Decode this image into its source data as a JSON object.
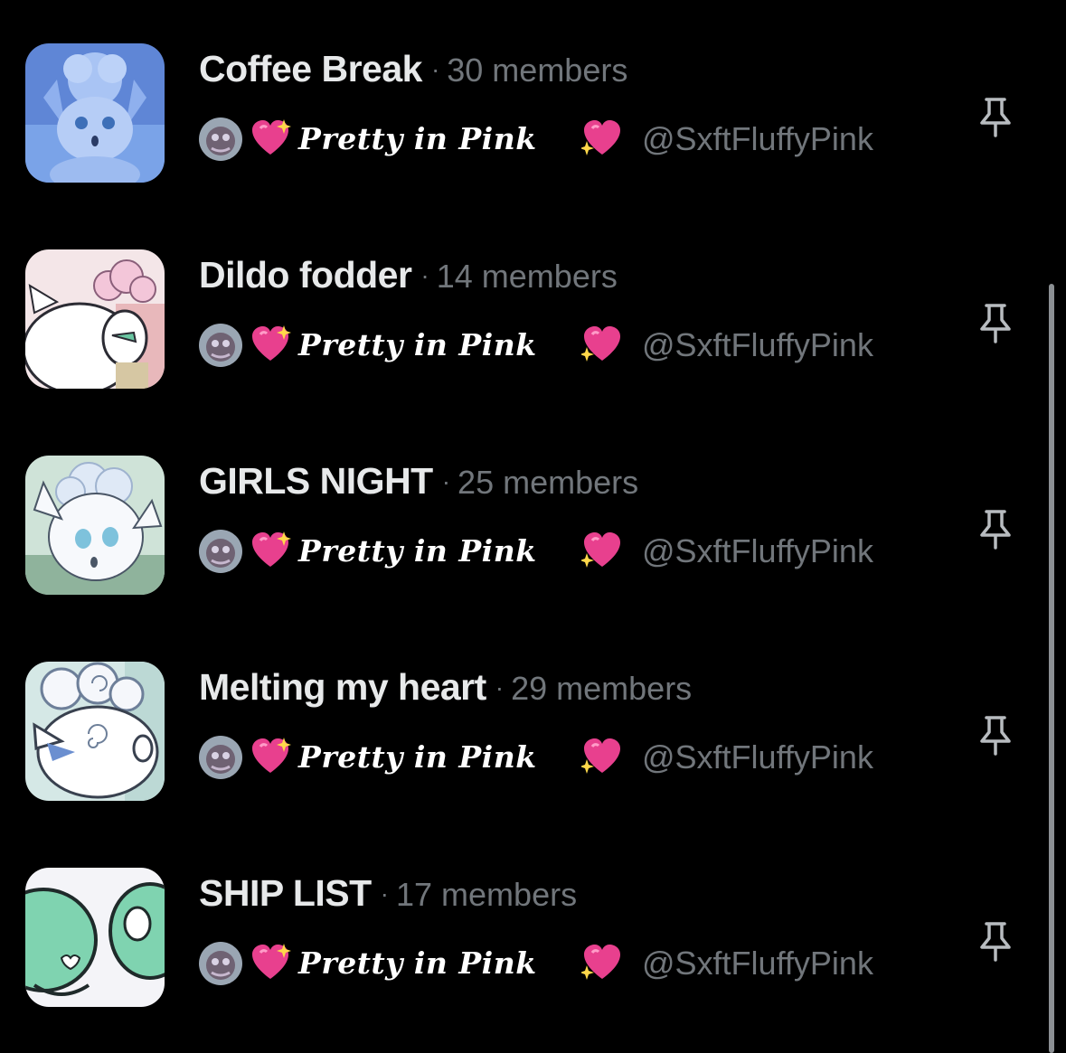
{
  "lists": [
    {
      "name": "Coffee Break",
      "separator": "·",
      "members": "30 members",
      "owner_display": "Pretty in Pink",
      "owner_handle": "@SxftFluffyPink",
      "thumb_icon": "fluffy-pokemon-blue-photo-icon"
    },
    {
      "name": "Dildo fodder",
      "separator": "·",
      "members": "14 members",
      "owner_display": "Pretty in Pink",
      "owner_handle": "@SxftFluffyPink",
      "thumb_icon": "fluffy-pokemon-pink-art-icon"
    },
    {
      "name": "GIRLS NIGHT",
      "separator": "·",
      "members": "25 members",
      "owner_display": "Pretty in Pink",
      "owner_handle": "@SxftFluffyPink",
      "thumb_icon": "fluffy-pokemon-white-art-icon"
    },
    {
      "name": "Melting my heart",
      "separator": "·",
      "members": "29 members",
      "owner_display": "Pretty in Pink",
      "owner_handle": "@SxftFluffyPink",
      "thumb_icon": "fluffy-pokemon-sketch-icon"
    },
    {
      "name": "SHIP LIST",
      "separator": "·",
      "members": "17 members",
      "owner_display": "Pretty in Pink",
      "owner_handle": "@SxftFluffyPink",
      "thumb_icon": "green-eyes-closeup-icon"
    }
  ],
  "colors": {
    "background": "#000000",
    "primary_text": "#e7e9ea",
    "secondary_text": "#71767b",
    "heart_pink": "#e8408e",
    "scrollbar": "#8b8f93"
  },
  "icons": {
    "pin": "pin-icon",
    "heart": "sparkling-heart-icon",
    "owner_avatar": "owner-avatar-icon"
  }
}
